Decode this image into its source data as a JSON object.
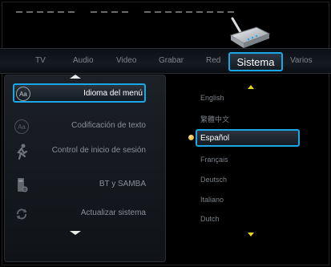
{
  "tabs": [
    {
      "label": "TV"
    },
    {
      "label": "Audio"
    },
    {
      "label": "Video"
    },
    {
      "label": "Grabar"
    },
    {
      "label": "Red"
    },
    {
      "label": "Sistema",
      "active": true
    },
    {
      "label": "Varios"
    }
  ],
  "menu": {
    "items": [
      {
        "label": "Idioma del menú",
        "icon": "language-icon",
        "selected": true
      },
      {
        "label": "Codificación de texto",
        "icon": "text-encoding-icon"
      },
      {
        "label": "Control de inicio de sesión",
        "icon": "login-control-icon"
      },
      {
        "label": "BT y SAMBA",
        "icon": "bt-samba-icon"
      },
      {
        "label": "Actualizar sistema",
        "icon": "update-system-icon"
      }
    ],
    "icon_text": "Aa"
  },
  "languages": {
    "items": [
      "English",
      "繁體中文",
      "Español",
      "Français",
      "Deutsch",
      "Italiano",
      "Dutch"
    ],
    "selected": "Español"
  },
  "colors": {
    "highlight_border": "#1aa7e8",
    "selected_dot": "#e0a21a",
    "scroll_arrow": "#e2d31e"
  }
}
